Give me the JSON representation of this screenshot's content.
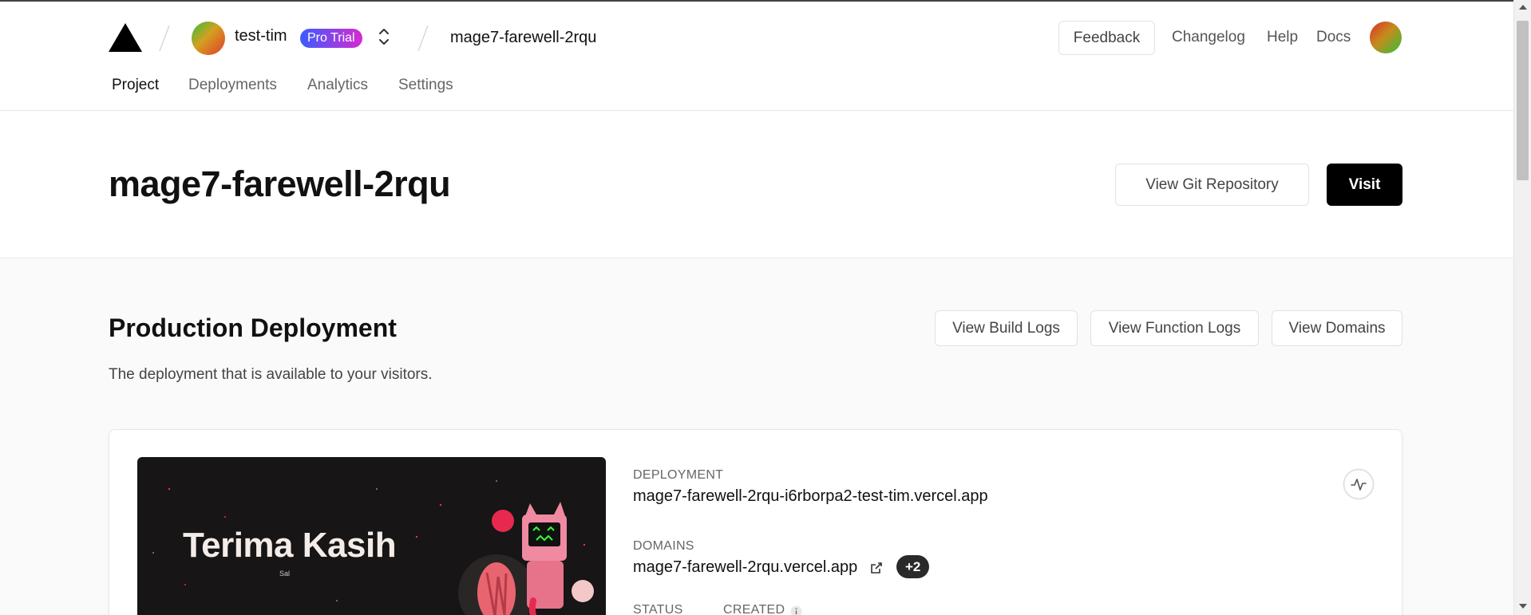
{
  "header": {
    "team_name": "test-tim",
    "plan_badge": "Pro Trial",
    "project_name": "mage7-farewell-2rqu",
    "links": {
      "feedback": "Feedback",
      "changelog": "Changelog",
      "help": "Help",
      "docs": "Docs"
    }
  },
  "tabs": [
    {
      "label": "Project",
      "active": true
    },
    {
      "label": "Deployments",
      "active": false
    },
    {
      "label": "Analytics",
      "active": false
    },
    {
      "label": "Settings",
      "active": false
    }
  ],
  "title_section": {
    "title": "mage7-farewell-2rqu",
    "view_git_label": "View Git Repository",
    "visit_label": "Visit"
  },
  "production": {
    "title": "Production Deployment",
    "subtitle": "The deployment that is available to your visitors.",
    "buttons": {
      "build_logs": "View Build Logs",
      "function_logs": "View Function Logs",
      "domains": "View Domains"
    },
    "card": {
      "preview": {
        "title": "Terima Kasih",
        "small_text": "Sal"
      },
      "deployment_label": "DEPLOYMENT",
      "deployment_url": "mage7-farewell-2rqu-i6rborpa2-test-tim.vercel.app",
      "domains_label": "DOMAINS",
      "domain": "mage7-farewell-2rqu.vercel.app",
      "extra_domains": "+2",
      "status_label": "STATUS",
      "created_label": "CREATED"
    }
  },
  "icons": {
    "logo": "vercel-triangle-icon",
    "switcher": "chevron-up-down-icon",
    "external": "external-link-icon",
    "info": "info-icon",
    "activity": "activity-pulse-icon"
  },
  "colors": {
    "primary_button": "#000000",
    "badge_gradient_start": "#3b5bff",
    "badge_gradient_end": "#d52bd1",
    "section_bg": "#fafafa"
  }
}
